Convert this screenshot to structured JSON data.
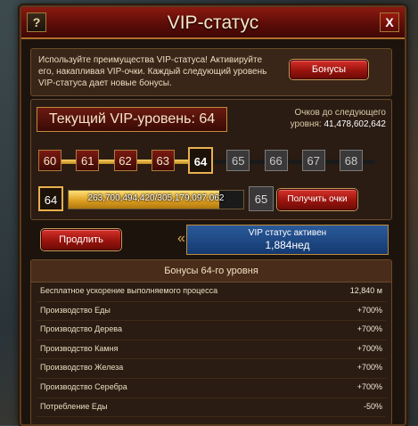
{
  "window": {
    "title": "VIP-статус",
    "help_label": "?",
    "close_label": "X"
  },
  "intro": {
    "text": "Используйте преимущества VIP-статуса! Активируйте его, накапливая VIP-очки. Каждый следующий уровень VIP-статуса дает новые бонусы.",
    "bonus_button": "Бонусы"
  },
  "vip": {
    "current_label": "Текущий VIP-уровень: 64",
    "next_label": "Очков до следующего уровня:",
    "next_value": "41,478,602,642",
    "levels": [
      "60",
      "61",
      "62",
      "63",
      "64",
      "65",
      "66",
      "67",
      "68"
    ],
    "current_level_index": 4,
    "progress": {
      "from": "64",
      "to": "65",
      "text": "263,700,494,420/305,179,097,062",
      "fraction": 0.864
    },
    "get_points_button": "Получить очки"
  },
  "status": {
    "extend_button": "Продлить",
    "line1": "VIP статус активен",
    "line2": "1,884нед"
  },
  "bonuses": {
    "heading": "Бонусы 64-го уровня",
    "rows": [
      {
        "name": "Бесплатное ускорение выполняемого процесса",
        "value": "12,840 м"
      },
      {
        "name": "Производство Еды",
        "value": "+700%"
      },
      {
        "name": "Производство Дерева",
        "value": "+700%"
      },
      {
        "name": "Производство Камня",
        "value": "+700%"
      },
      {
        "name": "Производство Железа",
        "value": "+700%"
      },
      {
        "name": "Производство Серебра",
        "value": "+700%"
      },
      {
        "name": "Потребление Еды",
        "value": "-50%"
      }
    ]
  }
}
